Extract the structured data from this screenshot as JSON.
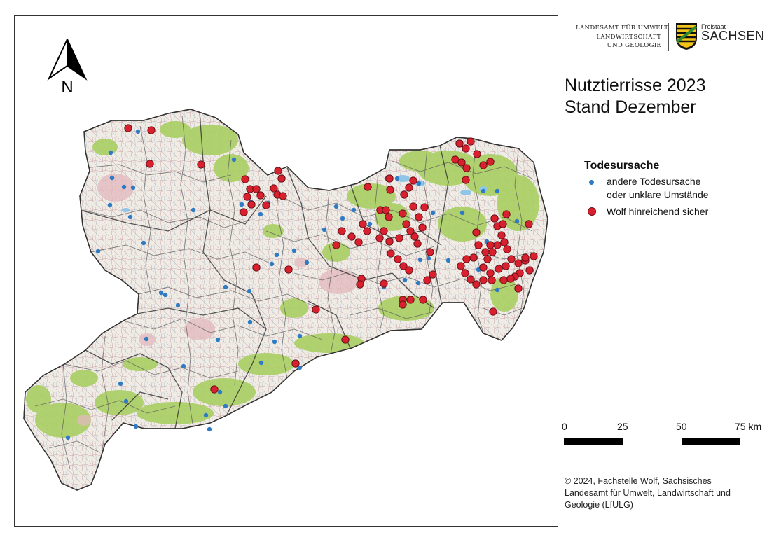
{
  "title_line1": "Nutztierrisse 2023",
  "title_line2": "Stand Dezember",
  "north_label": "N",
  "org": {
    "line1": "LANDESAMT FÜR UMWELT,",
    "line2": "LANDWIRTSCHAFT",
    "line3": "UND GEOLOGIE",
    "state_small": "Freistaat",
    "state_big": "SACHSEN"
  },
  "legend": {
    "title": "Todesursache",
    "other_line1": "andere Todesursache",
    "other_line2": "oder unklare Umstände",
    "wolf": "Wolf hinreichend sicher"
  },
  "scale": {
    "t0": "0",
    "t1": "25",
    "t2": "50",
    "t3": "75 km"
  },
  "credit": {
    "line1": "© 2024, Fachstelle Wolf, Sächsisches",
    "line2": "Landesamt für Umwelt, Landwirtschaft und",
    "line3": "Geologie (LfULG)"
  },
  "colors": {
    "wolf": "#d9202e",
    "other": "#2e7bc4",
    "land": "#f1eee8",
    "forest": "#a9cf62",
    "border": "#3d3d3d"
  }
}
